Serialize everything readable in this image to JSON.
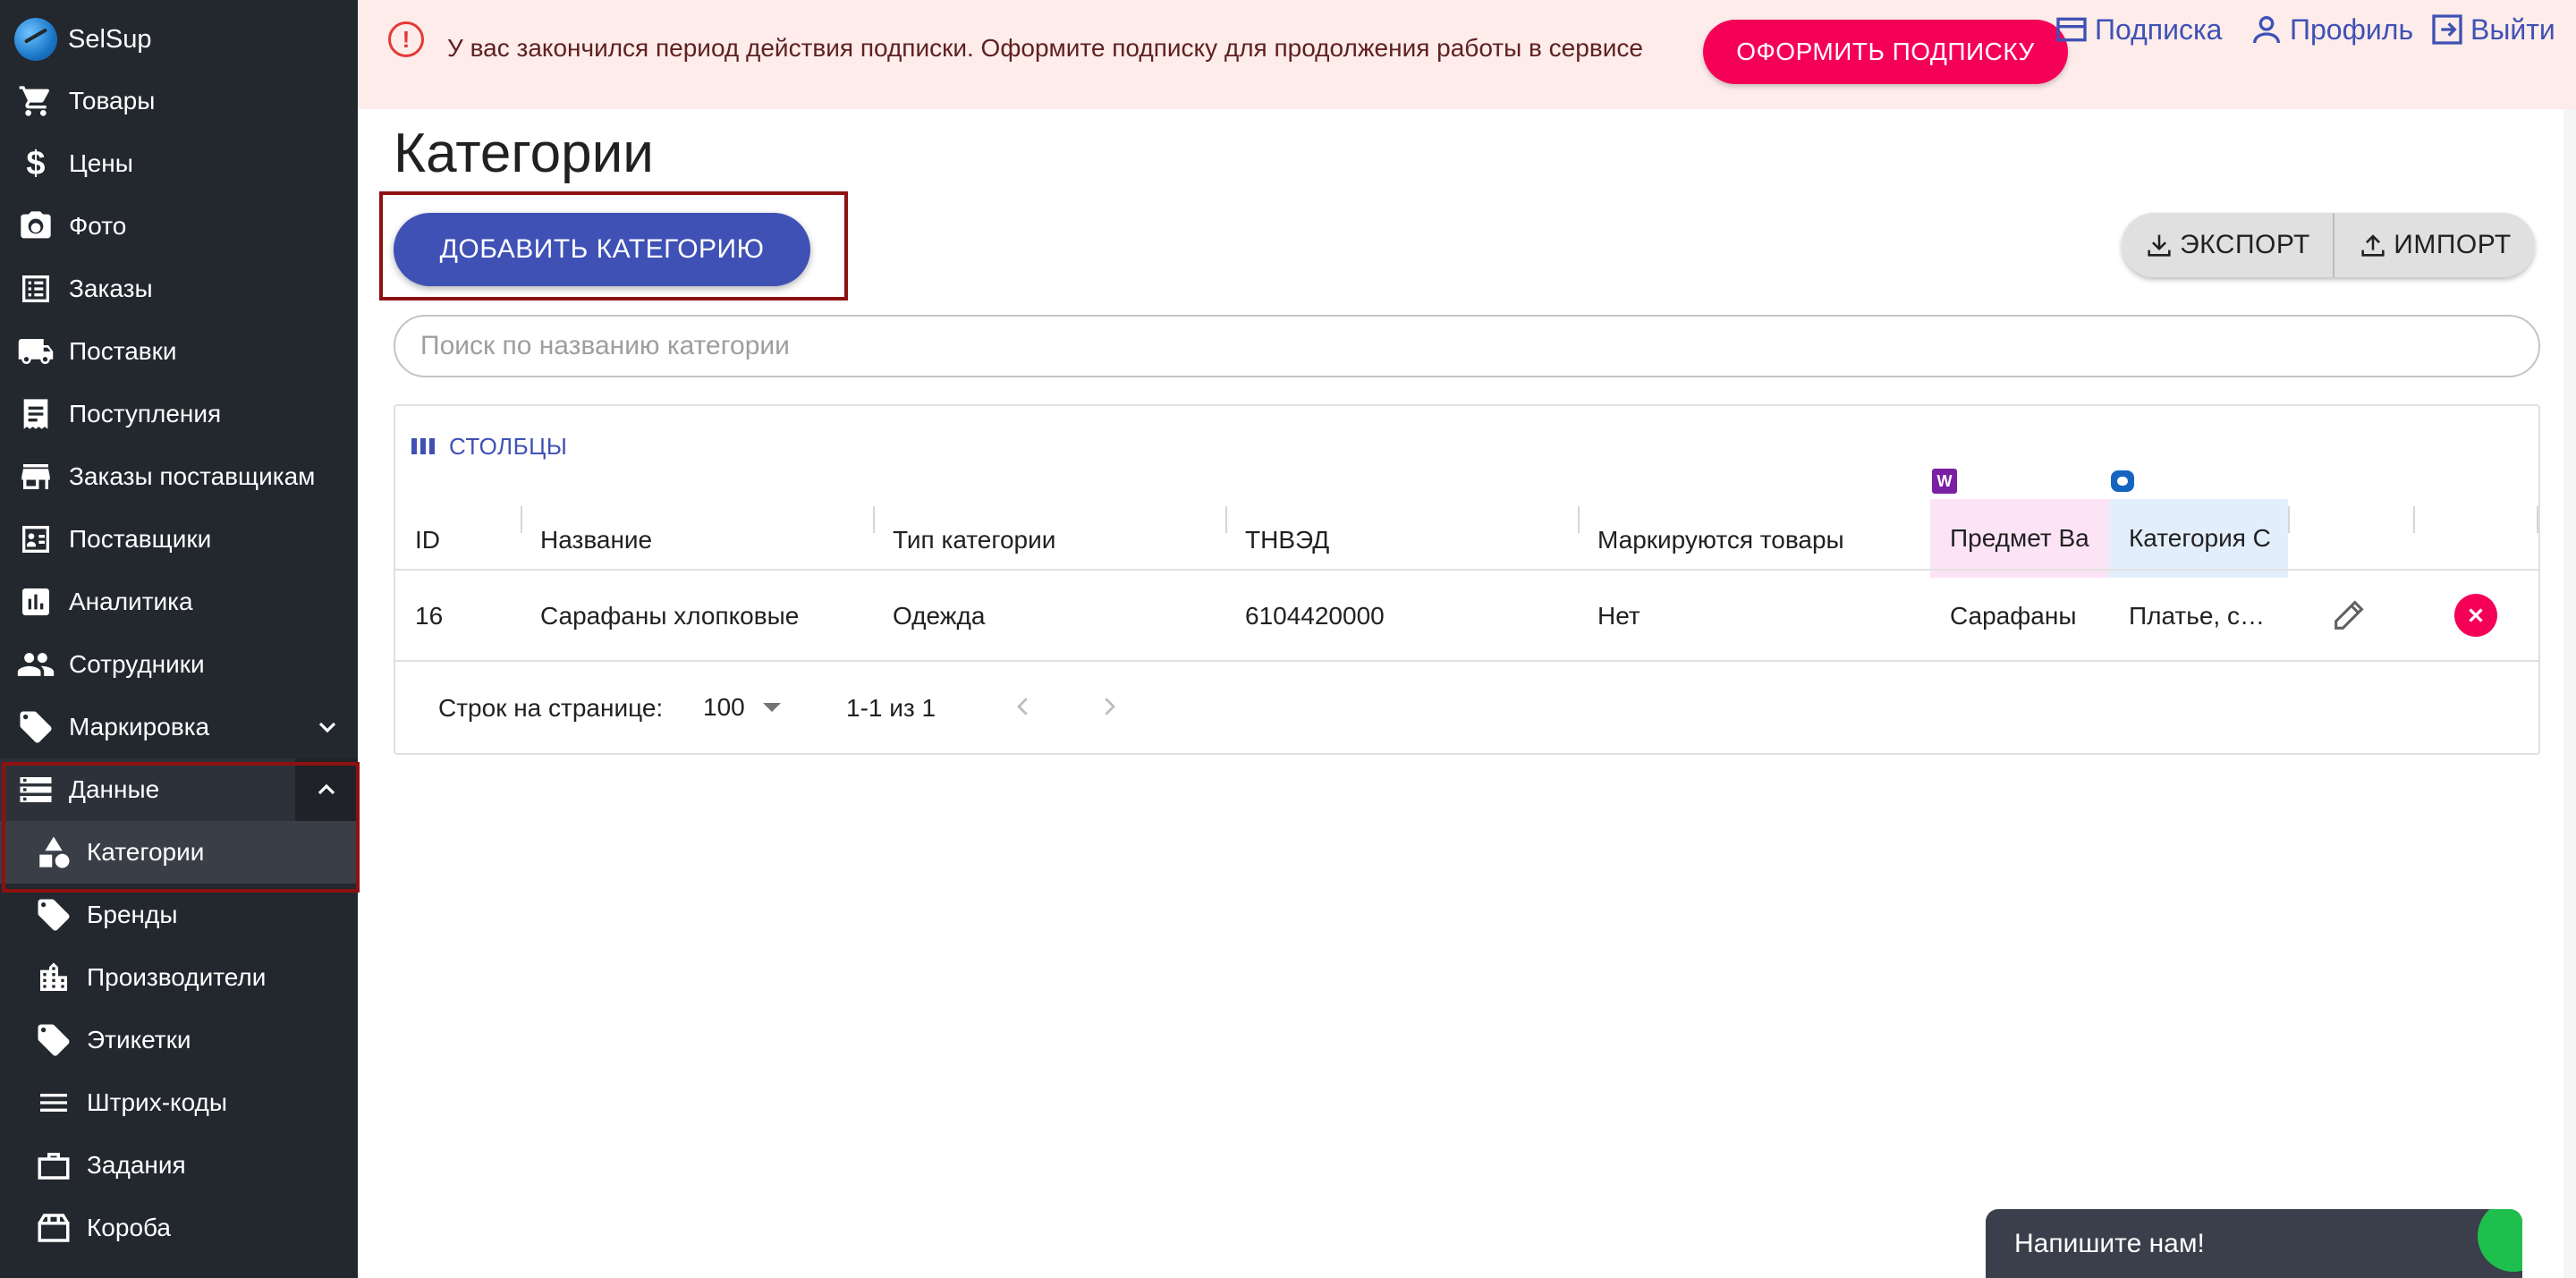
{
  "brand": {
    "name": "SelSup"
  },
  "sidebar": {
    "items": [
      {
        "label": "Товары",
        "icon": "cart-icon"
      },
      {
        "label": "Цены",
        "icon": "dollar-icon"
      },
      {
        "label": "Фото",
        "icon": "camera-icon"
      },
      {
        "label": "Заказы",
        "icon": "list-icon"
      },
      {
        "label": "Поставки",
        "icon": "truck-icon"
      },
      {
        "label": "Поступления",
        "icon": "receipt-icon"
      },
      {
        "label": "Заказы поставщикам",
        "icon": "store-icon"
      },
      {
        "label": "Поставщики",
        "icon": "contact-card-icon"
      },
      {
        "label": "Аналитика",
        "icon": "chart-icon"
      },
      {
        "label": "Сотрудники",
        "icon": "people-icon"
      },
      {
        "label": "Маркировка",
        "icon": "tags-icon",
        "expandable": true
      },
      {
        "label": "Данные",
        "icon": "storage-icon",
        "expanded": true
      }
    ],
    "sub_items": [
      {
        "label": "Категории",
        "icon": "category-shapes-icon",
        "active": true
      },
      {
        "label": "Бренды",
        "icon": "tags-icon"
      },
      {
        "label": "Производители",
        "icon": "building-icon"
      },
      {
        "label": "Этикетки",
        "icon": "label-icon"
      },
      {
        "label": "Штрих-коды",
        "icon": "barcode-lines-icon"
      },
      {
        "label": "Задания",
        "icon": "briefcase-icon"
      },
      {
        "label": "Короба",
        "icon": "box-icon"
      }
    ]
  },
  "banner": {
    "message": "У вас закончился период действия подписки. Оформите подписку для продолжения работы в сервисе",
    "subscribe_label": "ОФОРМИТЬ ПОДПИСКУ",
    "alert_icon": "!",
    "links": {
      "subscription": "Подписка",
      "profile": "Профиль",
      "logout": "Выйти"
    }
  },
  "page": {
    "title": "Категории",
    "add_label": "ДОБАВИТЬ КАТЕГОРИЮ",
    "export_label": "ЭКСПОРТ",
    "import_label": "ИМПОРТ",
    "search_placeholder": "Поиск по названию категории"
  },
  "table": {
    "columns_button": "СТОЛБЦЫ",
    "wb_badge": "W",
    "headers": [
      "ID",
      "Название",
      "Тип категории",
      "ТНВЭД",
      "Маркируются товары",
      "Предмет Ва",
      "Категория С"
    ],
    "rows": [
      {
        "id": "16",
        "name": "Сарафаны хлопковые",
        "type": "Одежда",
        "tnved": "6104420000",
        "marked": "Нет",
        "subject": "Сарафаны",
        "category": "Платье, с…"
      }
    ],
    "pagination": {
      "rows_label": "Строк на странице:",
      "rows_value": "100",
      "range": "1-1 из 1"
    }
  },
  "chat": {
    "label": "Напишите нам!"
  },
  "colors": {
    "primary": "#3f51b5",
    "accent": "#f50057",
    "sidebar": "#23272e",
    "banner": "#fdecea",
    "highlight": "#8e1111"
  }
}
